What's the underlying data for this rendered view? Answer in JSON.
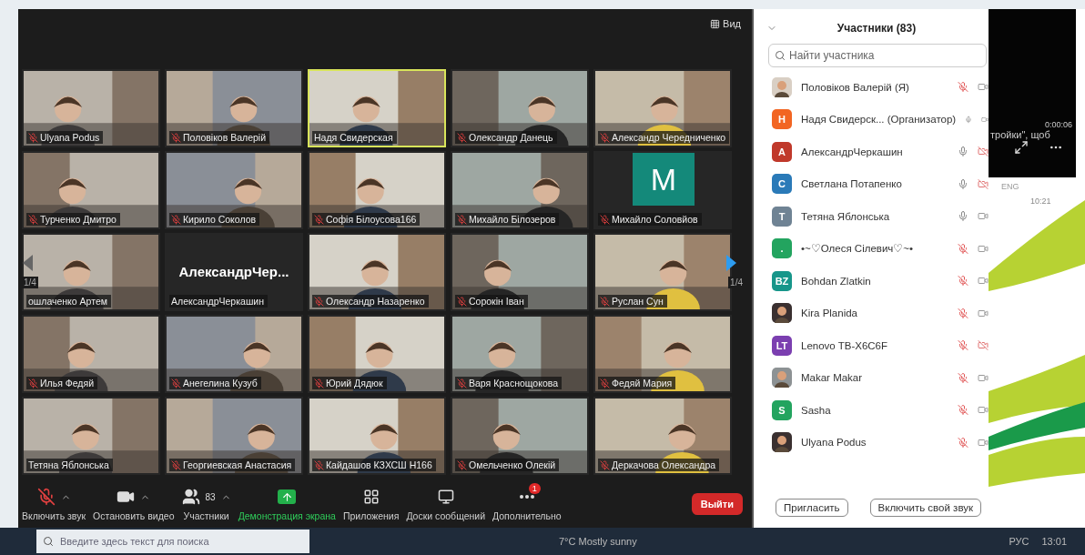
{
  "meeting": {
    "view_label": "Вид",
    "page_left": "1/4",
    "page_right": "1/4",
    "tiles": [
      {
        "name": "Ulyana Podus",
        "kind": "video",
        "muted": true,
        "speaking": false
      },
      {
        "name": "Половіков Валерій",
        "kind": "video",
        "muted": true,
        "speaking": false
      },
      {
        "name": "Надя Свидерская",
        "kind": "video",
        "muted": false,
        "speaking": true
      },
      {
        "name": "Олександр Данець",
        "kind": "video",
        "muted": true,
        "speaking": false
      },
      {
        "name": "Александр Чередниченко",
        "kind": "video",
        "muted": true,
        "speaking": false
      },
      {
        "name": "Турченко Дмитро",
        "kind": "video",
        "muted": true,
        "speaking": false
      },
      {
        "name": "Кирило Соколов",
        "kind": "video",
        "muted": true,
        "speaking": false
      },
      {
        "name": "Софія Білоусова166",
        "kind": "video",
        "muted": true,
        "speaking": false
      },
      {
        "name": "Михайло Білозеров",
        "kind": "video",
        "muted": true,
        "speaking": false
      },
      {
        "name": "Михайло Соловйов",
        "kind": "letter",
        "letter": "M",
        "color": "#14897a",
        "muted": true,
        "speaking": false
      },
      {
        "name": "ошлаченко Артем",
        "kind": "video",
        "muted": false,
        "speaking": false
      },
      {
        "name": "АлександрЧеркашин",
        "kind": "name",
        "display": "АлександрЧер...",
        "muted": false,
        "speaking": false
      },
      {
        "name": "Олександр Назаренко",
        "kind": "video",
        "muted": true,
        "speaking": false
      },
      {
        "name": "Сорокін Іван",
        "kind": "video",
        "muted": true,
        "speaking": false
      },
      {
        "name": "Руслан Сун",
        "kind": "video",
        "muted": true,
        "speaking": false
      },
      {
        "name": "Илья Федяй",
        "kind": "video",
        "muted": true,
        "speaking": false
      },
      {
        "name": "Анегелина Кузуб",
        "kind": "video",
        "muted": true,
        "speaking": false
      },
      {
        "name": "Юрий Дядюк",
        "kind": "video",
        "muted": true,
        "speaking": false
      },
      {
        "name": "Варя Краснощокова",
        "kind": "video",
        "muted": true,
        "speaking": false
      },
      {
        "name": "Федяй Мария",
        "kind": "video",
        "muted": true,
        "speaking": false
      },
      {
        "name": "Тетяна Яблонська",
        "kind": "video",
        "muted": false,
        "speaking": false
      },
      {
        "name": "Георгиевская Анастасия",
        "kind": "video",
        "muted": true,
        "speaking": false
      },
      {
        "name": "Кайдашов КЗХСШ Н166",
        "kind": "video",
        "muted": true,
        "speaking": false
      },
      {
        "name": "Омельченко Олекій",
        "kind": "video",
        "muted": true,
        "speaking": false
      },
      {
        "name": "Деркачова Олександра",
        "kind": "video",
        "muted": true,
        "speaking": false
      }
    ]
  },
  "toolbar": [
    {
      "kind": "mic",
      "label": "Включить звук"
    },
    {
      "kind": "video",
      "label": "Остановить видео"
    },
    {
      "kind": "participants",
      "label": "Участники",
      "count": "83"
    },
    {
      "kind": "share",
      "label": "Демонстрация экрана"
    },
    {
      "kind": "apps",
      "label": "Приложения"
    },
    {
      "kind": "board",
      "label": "Доски сообщений"
    },
    {
      "kind": "more",
      "label": "Дополнительно",
      "badge": "1"
    },
    {
      "kind": "leave",
      "label": "Выйти"
    }
  ],
  "participants": {
    "title": "Участники (83)",
    "search": {
      "placeholder": "Найти участника"
    },
    "items": [
      {
        "name": "Половіков Валерій (Я)",
        "kind": "picture",
        "muted": true,
        "camera_off": false
      },
      {
        "name": "Надя Свидерск... (Организатор)",
        "kind": "letter",
        "letter": "H",
        "color": "#f26522",
        "muted": false,
        "camera_off": false
      },
      {
        "name": "АлександрЧеркашин",
        "kind": "letter",
        "letter": "A",
        "color": "#c0392b",
        "muted": false,
        "camera_off": true
      },
      {
        "name": "Светлана Потапенко",
        "kind": "letter",
        "letter": "C",
        "color": "#2a7ab8",
        "muted": false,
        "camera_off": true
      },
      {
        "name": "Тетяна Яблонська",
        "kind": "letter",
        "letter": "T",
        "color": "#6f8394",
        "muted": false,
        "camera_off": false
      },
      {
        "name": "•~♡Олеся Сілевич♡~•",
        "kind": "letter",
        "letter": ".",
        "color": "#23a45f",
        "muted": true,
        "camera_off": false
      },
      {
        "name": "Bohdan Zlatkin",
        "kind": "letter",
        "letter": "BZ",
        "color": "#17968a",
        "muted": true,
        "camera_off": false
      },
      {
        "name": "Kira Planida",
        "kind": "picture",
        "muted": true,
        "camera_off": false
      },
      {
        "name": "Lenovo TB-X6C6F",
        "kind": "letter",
        "letter": "LT",
        "color": "#7b3fb0",
        "muted": true,
        "camera_off": true
      },
      {
        "name": "Makar Makar",
        "kind": "picture",
        "muted": true,
        "camera_off": false
      },
      {
        "name": "Sasha",
        "kind": "letter",
        "letter": "S",
        "color": "#23a45f",
        "muted": true,
        "camera_off": false
      },
      {
        "name": "Ulyana Podus",
        "kind": "picture",
        "muted": true,
        "camera_off": false
      }
    ],
    "buttons": [
      "Пригласить",
      "Включить свой звук"
    ]
  },
  "overlay": {
    "timer": "0:00:06",
    "caption": "тройки\", щоб",
    "lang": "ENG",
    "clock": "10:21"
  },
  "taskbar": {
    "search": {
      "placeholder": "Введите здесь текст для поиска"
    },
    "weather": "7°C  Mostly sunny",
    "lang": "РУС",
    "time": "13:01"
  }
}
